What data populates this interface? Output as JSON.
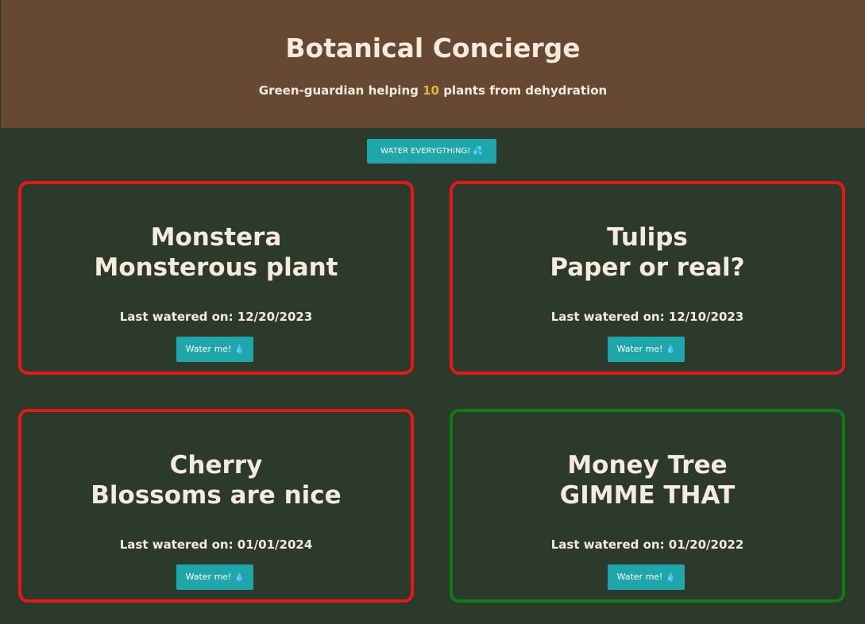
{
  "header": {
    "title": "Botanical Concierge",
    "subtitle_prefix": "Green-guardian helping ",
    "plant_count": "10",
    "subtitle_suffix": " plants from dehydration",
    "background_color": "#664833",
    "count_color": "#d9b84a"
  },
  "actions": {
    "water_all_label": "WATER EVERYGTHING!",
    "water_all_icon": "splash-drops-icon",
    "water_all_glyph": "💦"
  },
  "plants": [
    {
      "name": "Monstera",
      "description": "Monsterous plant",
      "last_watered_label": "Last watered on: ",
      "last_watered": "12/20/2023",
      "button_label": "Water me!",
      "button_glyph": "💧",
      "status": "needs-water",
      "border_color": "#e8161b"
    },
    {
      "name": "Tulips",
      "description": "Paper or real?",
      "last_watered_label": "Last watered on: ",
      "last_watered": "12/10/2023",
      "button_label": "Water me!",
      "button_glyph": "💧",
      "status": "needs-water",
      "border_color": "#e8161b"
    },
    {
      "name": "Cherry",
      "description": "Blossoms are nice",
      "last_watered_label": "Last watered on: ",
      "last_watered": "01/01/2024",
      "button_label": "Water me!",
      "button_glyph": "💧",
      "status": "needs-water",
      "border_color": "#e8161b"
    },
    {
      "name": "Money Tree",
      "description": "GIMME THAT",
      "last_watered_label": "Last watered on: ",
      "last_watered": "01/20/2022",
      "button_label": "Water me!",
      "button_glyph": "💧",
      "status": "ok",
      "border_color": "#0f7a16"
    }
  ],
  "colors": {
    "page_background": "#2b3a2b",
    "button": "#1fa6aa",
    "text": "#f5ebdd"
  }
}
